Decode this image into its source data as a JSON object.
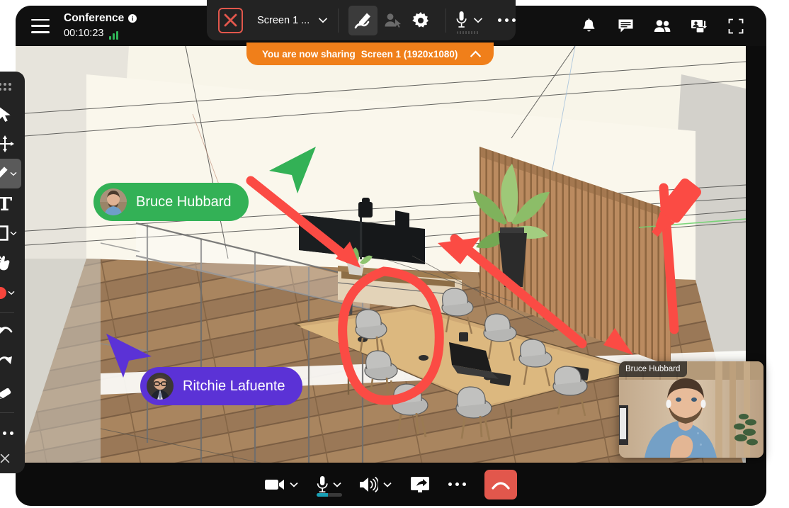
{
  "meeting": {
    "title": "Conference",
    "info_icon": "info-icon",
    "timer": "00:10:23",
    "signal_icon": "signal-strength-icon"
  },
  "header": {
    "menu_icon": "hamburger-menu-icon",
    "actions": [
      {
        "name": "notifications-button",
        "icon": "bell-icon"
      },
      {
        "name": "chat-button",
        "icon": "chat-bubble-icon"
      },
      {
        "name": "participants-button",
        "icon": "people-icon"
      },
      {
        "name": "invite-button",
        "icon": "add-participant-icon"
      },
      {
        "name": "fullscreen-button",
        "icon": "fullscreen-icon"
      }
    ]
  },
  "share_toolbar": {
    "stop_label": "stop-sharing-icon",
    "screen_label": "Screen 1 ...",
    "screen_caret": "chevron-down-icon",
    "annotate_icon": "pen-annotate-icon",
    "give_control_icon": "give-remote-control-icon",
    "settings_icon": "gear-icon",
    "mic_icon": "microphone-icon",
    "mic_caret": "chevron-down-icon",
    "more_icon": "more-options-icon"
  },
  "share_banner": {
    "message": "You are now sharing",
    "target": "Screen 1 (1920x1080)",
    "collapse_icon": "chevron-up-icon"
  },
  "annotation_toolbar": {
    "grip": "drag-handle-icon",
    "tools": [
      {
        "name": "select-tool",
        "icon": "cursor-arrow-icon",
        "active": false,
        "caret": false
      },
      {
        "name": "move-tool",
        "icon": "move-arrows-icon",
        "active": false,
        "caret": false
      },
      {
        "name": "pen-tool",
        "icon": "pen-icon",
        "active": true,
        "caret": true
      },
      {
        "name": "text-tool",
        "icon": "text-icon",
        "active": false,
        "caret": false
      },
      {
        "name": "shape-tool",
        "icon": "square-icon",
        "active": false,
        "caret": true
      },
      {
        "name": "stamp-tool",
        "icon": "hand-pointer-icon",
        "active": false,
        "caret": false
      },
      {
        "name": "color-picker",
        "icon": "color-swatch-icon",
        "active": false,
        "caret": true
      }
    ],
    "history": [
      {
        "name": "undo-button",
        "icon": "undo-arrow-icon"
      },
      {
        "name": "redo-button",
        "icon": "redo-arrow-icon"
      },
      {
        "name": "eraser-tool",
        "icon": "eraser-icon"
      }
    ],
    "more": {
      "name": "more-tools-button",
      "icon": "more-dots-icon"
    },
    "close": {
      "name": "close-annotation-toolbar",
      "icon": "close-x-icon"
    },
    "active_color": "#f7453c"
  },
  "participants": [
    {
      "name": "Bruce Hubbard",
      "color": "#33b156",
      "cursor": "green-cursor"
    },
    {
      "name": "Ritchie Lafuente",
      "color": "#5b32d6",
      "cursor": "purple-cursor"
    }
  ],
  "self_view": {
    "name": "Bruce Hubbard"
  },
  "bottom_bar": {
    "controls": [
      {
        "name": "camera-button",
        "icon": "video-camera-icon",
        "caret": true
      },
      {
        "name": "microphone-button",
        "icon": "microphone-icon",
        "caret": true
      },
      {
        "name": "speaker-button",
        "icon": "speaker-icon",
        "caret": true
      },
      {
        "name": "share-screen-button",
        "icon": "share-screen-icon",
        "caret": false
      },
      {
        "name": "more-button",
        "icon": "more-dots-icon",
        "caret": false
      }
    ],
    "hangup": {
      "name": "hangup-button",
      "icon": "phone-hangup-icon"
    }
  },
  "colors": {
    "accent_orange": "#f07f1a",
    "danger_red": "#e2574c",
    "annotation_red": "#f7453c",
    "green": "#33b156",
    "purple": "#5b32d6",
    "mic_level": "#18a0b5"
  }
}
